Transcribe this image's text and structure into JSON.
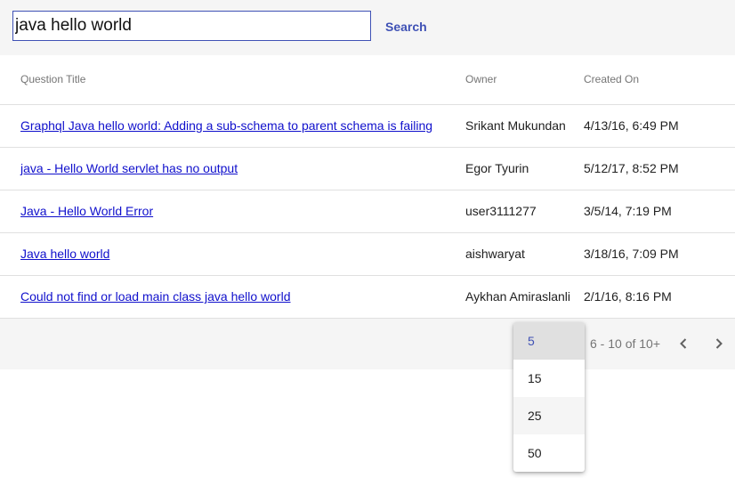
{
  "search": {
    "value": "java hello world",
    "button_label": "Search"
  },
  "table": {
    "columns": [
      "Question Title",
      "Owner",
      "Created On"
    ],
    "rows": [
      {
        "title": "Graphql Java hello world: Adding a sub-schema to parent schema is failing",
        "owner": "Srikant Mukundan",
        "created": "4/13/16, 6:49 PM"
      },
      {
        "title": "java - Hello World servlet has no output",
        "owner": "Egor Tyurin",
        "created": "5/12/17, 8:52 PM"
      },
      {
        "title": "Java - Hello World Error",
        "owner": "user3111277",
        "created": "3/5/14, 7:19 PM"
      },
      {
        "title": "Java hello world",
        "owner": "aishwaryat",
        "created": "3/18/16, 7:09 PM"
      },
      {
        "title": "Could not find or load main class java hello world",
        "owner": "Aykhan Amiraslanli",
        "created": "2/1/16, 8:16 PM"
      }
    ]
  },
  "pagination": {
    "range_text": "6 - 10 of 10+",
    "prev_icon": "chevron-left-icon",
    "next_icon": "chevron-right-icon",
    "page_size_options": [
      "5",
      "15",
      "25",
      "50"
    ],
    "selected_page_size": "5"
  },
  "colors": {
    "accent": "#3f51b5",
    "link": "#1010cc",
    "header_bg": "#f5f5f5"
  }
}
